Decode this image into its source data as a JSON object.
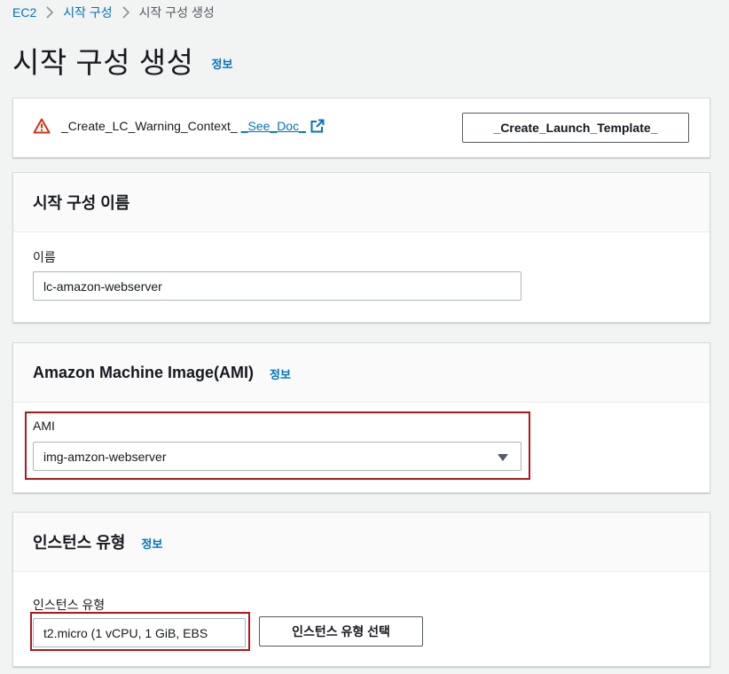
{
  "breadcrumb": {
    "items": [
      "EC2",
      "시작 구성",
      "시작 구성 생성"
    ]
  },
  "page": {
    "title": "시작 구성 생성",
    "info_label": "정보"
  },
  "warning": {
    "text": "_Create_LC_Warning_Context_",
    "link_label": "_See_Doc_",
    "button_label": "_Create_Launch_Template_"
  },
  "name_section": {
    "title": "시작 구성 이름",
    "field_label": "이름",
    "field_value": "lc-amazon-webserver"
  },
  "ami_section": {
    "title": "Amazon Machine Image(AMI)",
    "info_label": "정보",
    "field_label": "AMI",
    "selected_value": "img-amzon-webserver"
  },
  "instance_section": {
    "title": "인스턴스 유형",
    "info_label": "정보",
    "field_label": "인스턴스 유형",
    "field_value": "t2.micro (1 vCPU, 1 GiB, EBS",
    "choose_button_label": "인스턴스 유형 선택"
  },
  "colors": {
    "link": "#0073bb",
    "warning": "#d13212",
    "highlight": "#b0171f",
    "background": "#f2f3f3"
  }
}
